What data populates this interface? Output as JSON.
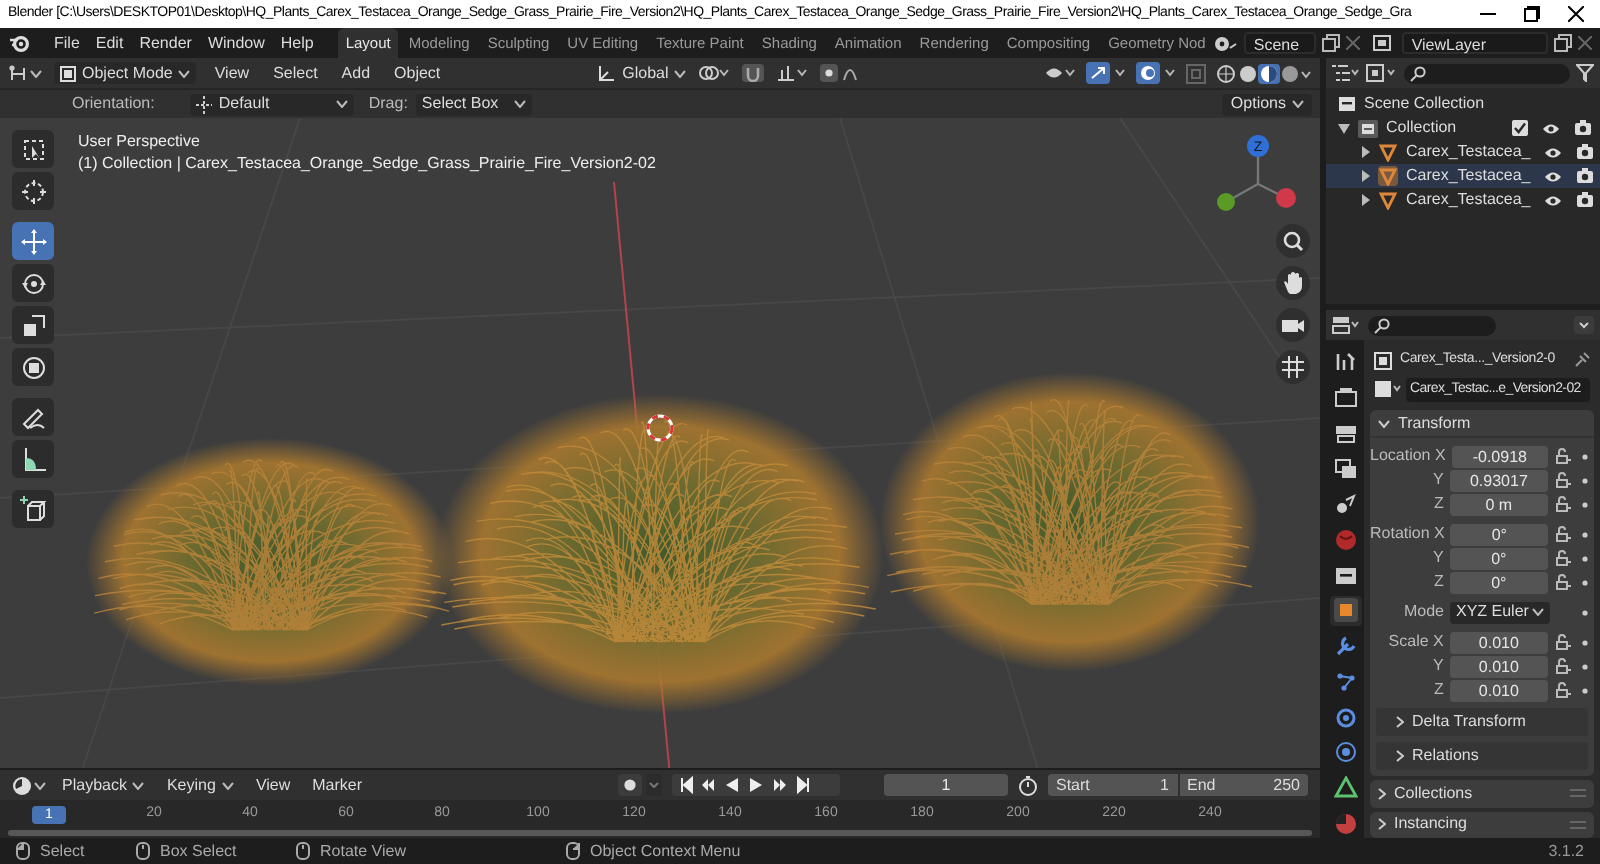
{
  "title_bar": {
    "title": "Blender [C:\\Users\\DESKTOP01\\Desktop\\HQ_Plants_Carex_Testacea_Orange_Sedge_Grass_Prairie_Fire_Version2\\HQ_Plants_Carex_Testacea_Orange_Sedge_Grass_Prairie_Fire_Version2\\HQ_Plants_Carex_Testacea_Orange_Sedge_Gra"
  },
  "menu": [
    "File",
    "Edit",
    "Render",
    "Window",
    "Help"
  ],
  "workspace_tabs": [
    {
      "label": "Layout",
      "selected": true
    },
    {
      "label": "Modeling",
      "selected": false
    },
    {
      "label": "Sculpting",
      "selected": false
    },
    {
      "label": "UV Editing",
      "selected": false
    },
    {
      "label": "Texture Paint",
      "selected": false
    },
    {
      "label": "Shading",
      "selected": false
    },
    {
      "label": "Animation",
      "selected": false
    },
    {
      "label": "Rendering",
      "selected": false
    },
    {
      "label": "Compositing",
      "selected": false
    },
    {
      "label": "Geometry Nod",
      "selected": false
    }
  ],
  "scene": {
    "value": "Scene"
  },
  "view_layer": {
    "value": "ViewLayer"
  },
  "viewport_header": {
    "mode": "Object Mode",
    "menus": [
      "View",
      "Select",
      "Add",
      "Object"
    ],
    "orientation": "Global"
  },
  "tool_settings": {
    "orientation_label": "Orientation:",
    "orientation": "Default",
    "drag_label": "Drag:",
    "drag": "Select Box",
    "options": "Options"
  },
  "toolbar": [
    {
      "kind": "select_box",
      "selected": false
    },
    {
      "kind": "cursor",
      "selected": false
    },
    {
      "kind": "move",
      "selected": true
    },
    {
      "kind": "rotate",
      "selected": false
    },
    {
      "kind": "scale",
      "selected": false
    },
    {
      "kind": "transform",
      "selected": false
    },
    {
      "kind": "annotate",
      "selected": false
    },
    {
      "kind": "measure",
      "selected": false
    },
    {
      "kind": "add_cube",
      "selected": false
    }
  ],
  "navigation_gizmo": {
    "axes": [
      {
        "label": "Z",
        "color": "#2f6fd6"
      }
    ]
  },
  "viewport": {
    "perspective": "User Perspective",
    "object_info": "(1) Collection | Carex_Testacea_Orange_Sedge_Grass_Prairie_Fire_Version2-02"
  },
  "outliner": {
    "root": "Scene Collection",
    "items": [
      {
        "label": "Collection",
        "children": [
          {
            "label": "Carex_Testacea_",
            "selected": false
          },
          {
            "label": "Carex_Testacea_",
            "selected": true
          },
          {
            "label": "Carex_Testacea_",
            "selected": false
          }
        ]
      }
    ]
  },
  "property_tabs": [
    {
      "kind": "tool",
      "selected": false
    },
    {
      "kind": "render",
      "selected": false
    },
    {
      "kind": "output",
      "selected": false
    },
    {
      "kind": "view_layer",
      "selected": false
    },
    {
      "kind": "scene",
      "selected": false
    },
    {
      "kind": "world",
      "selected": false
    },
    {
      "kind": "collection",
      "selected": false
    },
    {
      "kind": "object",
      "selected": true
    },
    {
      "kind": "modifier",
      "selected": false
    },
    {
      "kind": "particles",
      "selected": false
    },
    {
      "kind": "physics",
      "selected": false
    },
    {
      "kind": "constraints",
      "selected": false
    },
    {
      "kind": "data",
      "selected": false
    },
    {
      "kind": "material",
      "selected": false
    }
  ],
  "properties": {
    "object_name": "Carex_Testa..._Version2-0",
    "data_name": "Carex_Testac...e_Version2-02",
    "transform_title": "Transform",
    "rows": [
      {
        "kind": "field",
        "label": "Location X",
        "value": "-0.0918"
      },
      {
        "kind": "field",
        "label": "Y",
        "value": "0.93017"
      },
      {
        "kind": "field",
        "label": "Z",
        "value": "0 m"
      },
      {
        "kind": "field",
        "label": "Rotation X",
        "value": "0°"
      },
      {
        "kind": "field",
        "label": "Y",
        "value": "0°"
      },
      {
        "kind": "field",
        "label": "Z",
        "value": "0°"
      },
      {
        "kind": "dropdown",
        "label": "Mode",
        "value": "XYZ Euler"
      },
      {
        "kind": "field",
        "label": "Scale X",
        "value": "0.010"
      },
      {
        "kind": "field",
        "label": "Y",
        "value": "0.010"
      },
      {
        "kind": "field",
        "label": "Z",
        "value": "0.010"
      }
    ],
    "subpanels": [
      "Delta Transform",
      "Relations"
    ],
    "panels": [
      "Collections",
      "Instancing"
    ]
  },
  "timeline": {
    "menus": [
      "Playback",
      "Keying",
      "View",
      "Marker"
    ],
    "current_frame": "1",
    "start_label": "Start",
    "start": "1",
    "end_label": "End",
    "end": "250",
    "ruler": [
      {
        "label": "1",
        "current": true
      },
      {
        "label": "20",
        "current": false
      },
      {
        "label": "40",
        "current": false
      },
      {
        "label": "60",
        "current": false
      },
      {
        "label": "80",
        "current": false
      },
      {
        "label": "100",
        "current": false
      },
      {
        "label": "120",
        "current": false
      },
      {
        "label": "140",
        "current": false
      },
      {
        "label": "160",
        "current": false
      },
      {
        "label": "180",
        "current": false
      },
      {
        "label": "200",
        "current": false
      },
      {
        "label": "220",
        "current": false
      },
      {
        "label": "240",
        "current": false
      }
    ]
  },
  "status_bar": {
    "hints": [
      "Select",
      "Box Select",
      "Rotate View",
      "Object Context Menu"
    ],
    "version": "3.1.2"
  }
}
